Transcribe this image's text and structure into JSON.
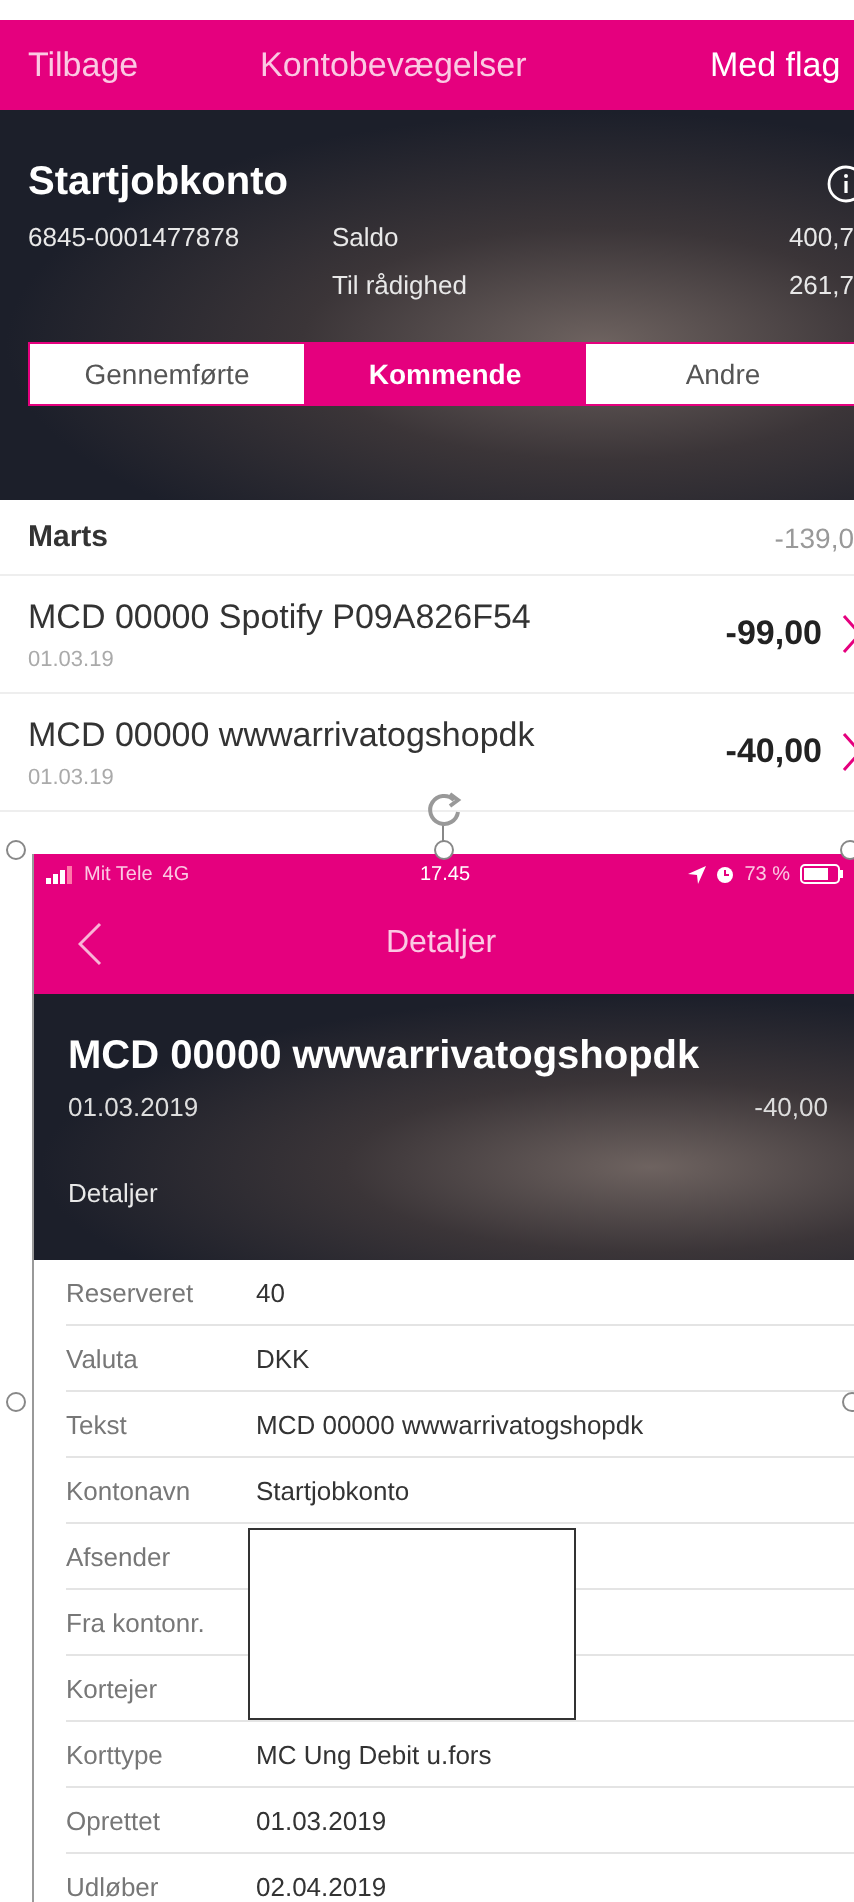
{
  "top_nav": {
    "back": "Tilbage",
    "title": "Kontobevægelser",
    "action": "Med flag"
  },
  "account": {
    "name": "Startjobkonto",
    "number": "6845-0001477878",
    "balances": [
      {
        "label": "Saldo",
        "amount": "400,7"
      },
      {
        "label": "Til rådighed",
        "amount": "261,7"
      }
    ]
  },
  "tabs": [
    {
      "label": "Gennemførte",
      "selected": false
    },
    {
      "label": "Kommende",
      "selected": true
    },
    {
      "label": "Andre",
      "selected": false
    }
  ],
  "month": {
    "label": "Marts",
    "total": "-139,0"
  },
  "transactions": [
    {
      "text": "MCD 00000 Spotify P09A826F54",
      "date": "01.03.19",
      "amount": "-99,00"
    },
    {
      "text": "MCD 00000 wwwarrivatogshopdk",
      "date": "01.03.19",
      "amount": "-40,00"
    }
  ],
  "detail_screen": {
    "status_bar": {
      "carrier": "Mit Tele",
      "network": "4G",
      "time": "17.45",
      "battery": "73 %"
    },
    "nav_title": "Detaljer",
    "header": {
      "title": "MCD 00000 wwwarrivatogshopdk",
      "date": "01.03.2019",
      "amount": "-40,00",
      "section": "Detaljer"
    },
    "rows": [
      {
        "label": "Reserveret",
        "value": "40"
      },
      {
        "label": "Valuta",
        "value": "DKK"
      },
      {
        "label": "Tekst",
        "value": "MCD 00000 wwwarrivatogshopdk"
      },
      {
        "label": "Kontonavn",
        "value": "Startjobkonto"
      },
      {
        "label": "Afsender"
      },
      {
        "label": "Fra kontonr."
      },
      {
        "label": "Kortejer"
      },
      {
        "label": "Korttype",
        "value": "MC Ung Debit u.fors"
      },
      {
        "label": "Oprettet",
        "value": "01.03.2019"
      },
      {
        "label": "Udløber",
        "value": "02.04.2019"
      }
    ]
  }
}
